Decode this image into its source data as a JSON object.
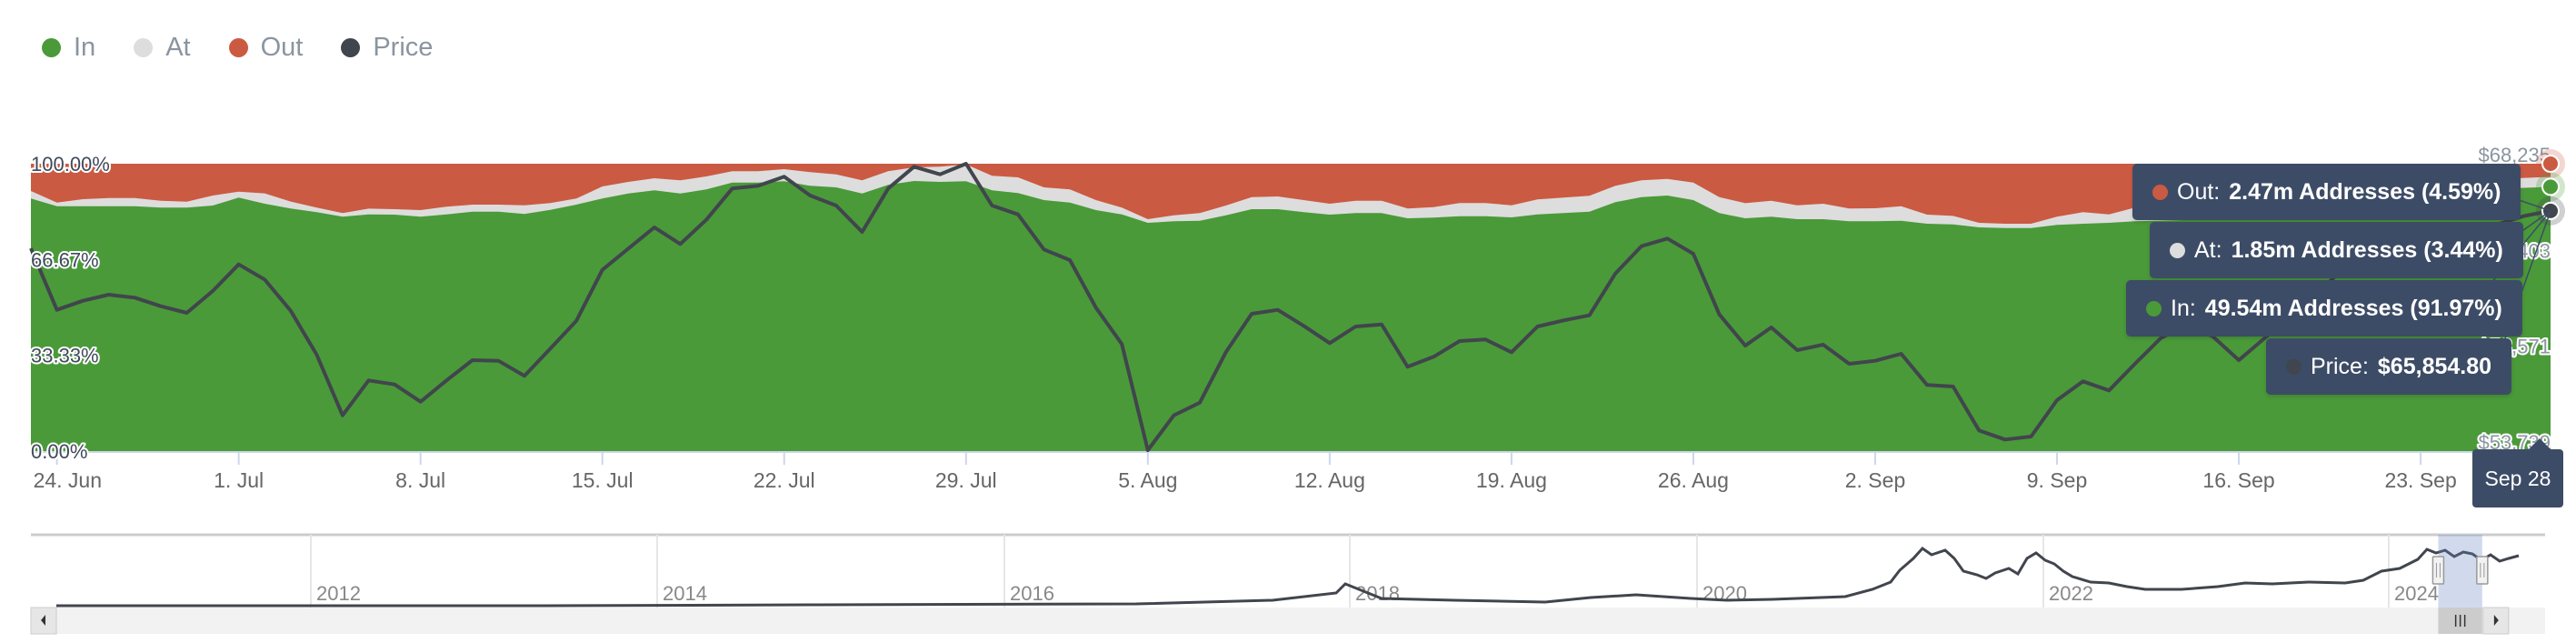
{
  "legend": [
    {
      "key": "in",
      "label": "In",
      "color": "#4a9a39"
    },
    {
      "key": "at",
      "label": "At",
      "color": "#dddddd"
    },
    {
      "key": "out",
      "label": "Out",
      "color": "#cb5a42"
    },
    {
      "key": "price",
      "label": "Price",
      "color": "#41454d"
    }
  ],
  "tooltip": {
    "out": {
      "label": "Out:",
      "value": "2.47m Addresses (4.59%)"
    },
    "at": {
      "label": "At:",
      "value": "1.85m Addresses (3.44%)"
    },
    "in": {
      "label": "In:",
      "value": "49.54m Addresses (91.97%)"
    },
    "price": {
      "label": "Price:",
      "value": "$65,854.80"
    },
    "date": "Sep 28"
  },
  "chart_data": {
    "type": "area",
    "stacked_percent": true,
    "title": "",
    "xlabel": "",
    "ylabel_left": "",
    "ylabel_right": "",
    "x_start": "2024-06-23",
    "x_end": "2024-09-28",
    "x_interval": "daily",
    "x_ticks": [
      "24. Jun",
      "1. Jul",
      "8. Jul",
      "15. Jul",
      "22. Jul",
      "29. Jul",
      "5. Aug",
      "12. Aug",
      "19. Aug",
      "26. Aug",
      "2. Sep",
      "9. Sep",
      "16. Sep",
      "23. Sep"
    ],
    "x_tick_day_offsets": [
      1,
      8,
      15,
      22,
      29,
      36,
      43,
      50,
      57,
      64,
      71,
      78,
      85,
      92
    ],
    "y_left_ticks": [
      "0.00%",
      "33.33%",
      "66.67%",
      "100.00%"
    ],
    "y_left_range": [
      0,
      100
    ],
    "y_right_ticks": [
      "$53,739",
      "$58,571",
      "$63,403",
      "$68,235"
    ],
    "y_right_range": [
      53739,
      68235
    ],
    "grid": false,
    "legend_position": "top-left",
    "series": [
      {
        "name": "In",
        "unit": "%",
        "values": [
          87.87,
          85.23,
          85.23,
          85.23,
          85.23,
          84.7,
          84.7,
          85.44,
          88.19,
          86.08,
          84.39,
          83.12,
          81.54,
          82.38,
          82.28,
          81.54,
          82.38,
          83.33,
          83.33,
          82.49,
          83.97,
          85.76,
          87.87,
          89.66,
          90.72,
          89.66,
          91.03,
          93.46,
          93.46,
          93.88,
          92.3,
          91.77,
          89.66,
          92.62,
          93.99,
          93.67,
          93.88,
          90.72,
          89.77,
          87.34,
          86.5,
          83.86,
          82.38,
          79.43,
          79.96,
          80.17,
          82.07,
          84.18,
          84.18,
          83.12,
          82.28,
          82.81,
          82.81,
          81.01,
          81.22,
          81.75,
          81.75,
          81.33,
          82.38,
          82.81,
          83.33,
          86.6,
          88.4,
          88.92,
          87.34,
          82.81,
          81.01,
          81.54,
          80.7,
          80.7,
          79.96,
          79.96,
          80.17,
          79.11,
          78.9,
          77.85,
          77.64,
          77.64,
          78.69,
          79.11,
          79.43,
          79.96,
          80.2,
          80.4,
          80.9,
          81.5,
          82.3,
          83.5,
          84.8,
          86.0,
          87.2,
          88.3,
          89.3,
          90.0,
          90.6,
          91.2,
          91.6,
          91.97
        ]
      },
      {
        "name": "At",
        "unit": "%",
        "values": [
          2.64,
          1.27,
          2.43,
          2.85,
          2.85,
          2.43,
          2.11,
          3.48,
          2.11,
          3.59,
          2.43,
          1.58,
          1.27,
          2.0,
          1.9,
          2.32,
          2.64,
          2.43,
          2.43,
          3.06,
          2.32,
          2.11,
          4.22,
          4.01,
          4.22,
          4.54,
          4.54,
          3.9,
          3.9,
          4.22,
          4.75,
          4.54,
          4.54,
          4.75,
          4.75,
          5.27,
          5.91,
          5.06,
          5.49,
          4.43,
          4.54,
          3.48,
          2.32,
          1.27,
          2.11,
          2.64,
          3.38,
          4.22,
          4.43,
          4.22,
          3.8,
          4.32,
          4.32,
          3.38,
          3.69,
          4.54,
          4.54,
          4.22,
          5.17,
          5.38,
          5.49,
          5.7,
          5.8,
          5.8,
          6.12,
          5.59,
          5.27,
          5.59,
          4.85,
          5.38,
          4.43,
          4.54,
          5.06,
          3.16,
          2.95,
          1.58,
          1.48,
          1.48,
          2.85,
          4.01,
          2.95,
          4.75,
          4.6,
          4.5,
          4.4,
          4.3,
          4.2,
          4.1,
          4.0,
          3.9,
          3.8,
          3.75,
          3.7,
          3.6,
          3.55,
          3.5,
          3.47,
          3.44
        ]
      },
      {
        "name": "Out",
        "unit": "%",
        "values": "remainder to 100%"
      },
      {
        "name": "Price",
        "unit": "USD",
        "axis": "right",
        "values": [
          63969,
          60865,
          61323,
          61629,
          61476,
          61048,
          60712,
          61813,
          63158,
          62393,
          60819,
          58602,
          55543,
          57302,
          57103,
          56231,
          57302,
          58326,
          58296,
          57531,
          58907,
          60314,
          62883,
          63953,
          65024,
          64183,
          65406,
          66981,
          67119,
          67578,
          66630,
          66125,
          64795,
          66981,
          68082,
          67700,
          68235,
          66125,
          65682,
          63908,
          63372,
          60972,
          59137,
          53785,
          55543,
          56185,
          58724,
          60666,
          60865,
          60054,
          59183,
          60024,
          60131,
          57990,
          58495,
          59290,
          59366,
          58724,
          60024,
          60329,
          60589,
          62699,
          64076,
          64458,
          63694,
          60635,
          59060,
          59978,
          58831,
          59106,
          58143,
          58296,
          58648,
          57072,
          56996,
          54779,
          54320,
          54473,
          56308,
          57256,
          56797,
          58143,
          59443,
          60131,
          59519,
          58326,
          59443,
          60500,
          61700,
          62900,
          63200,
          63000,
          63600,
          64100,
          63800,
          65200,
          65600,
          65854.8
        ]
      }
    ],
    "hover_point": {
      "date": "Sep 28",
      "in_pct": 91.97,
      "at_pct": 3.44,
      "out_pct": 4.59,
      "in_addresses": "49.54m",
      "at_addresses": "1.85m",
      "out_addresses": "2.47m",
      "price": 65854.8
    }
  },
  "navigator": {
    "years": [
      "2012",
      "2014",
      "2016",
      "2018",
      "2020",
      "2022",
      "2024"
    ],
    "selection_fraction": [
      0.9575,
      0.975
    ]
  }
}
